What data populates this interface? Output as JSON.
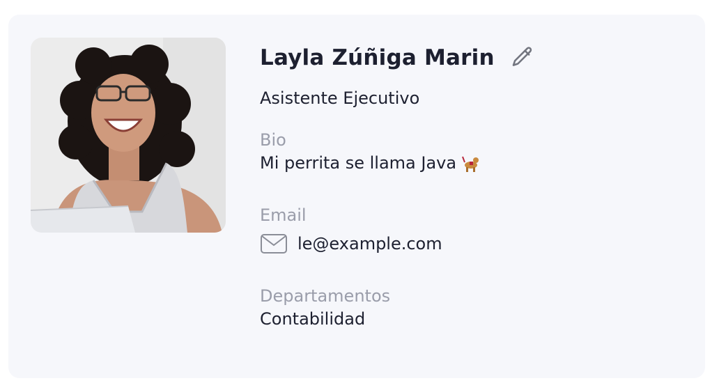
{
  "profile": {
    "name": "Layla Zúñiga Marin",
    "job_title": "Asistente Ejecutivo",
    "bio_label": "Bio",
    "bio_text": "Mi perrita se llama Java",
    "email_label": "Email",
    "email_value": "le@example.com",
    "departments_label": "Departamentos",
    "departments_value": "Contabilidad"
  },
  "icons": {
    "edit": "pencil-icon",
    "email": "envelope-icon",
    "bio_emoji": "guide-dog-emoji"
  },
  "colors": {
    "card_background": "#f6f7fb",
    "text_primary": "#1d2030",
    "text_secondary": "#9a9daa"
  }
}
